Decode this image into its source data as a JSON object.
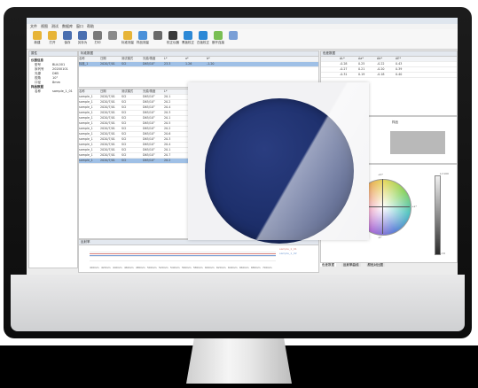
{
  "app": {
    "title": "",
    "menu": [
      "文件",
      "视图",
      "测试",
      "数据库",
      "窗口",
      "帮助"
    ],
    "toolbar": [
      {
        "label": "新建",
        "icon": "folder-icon",
        "color": "#e7b437"
      },
      {
        "label": "打开",
        "icon": "open-icon",
        "color": "#e7b437"
      },
      {
        "label": "保存",
        "icon": "save-icon",
        "color": "#4a6fb0"
      },
      {
        "label": "另存为",
        "icon": "save-as-icon",
        "color": "#4a6fb0"
      },
      {
        "label": "打印",
        "icon": "print-icon",
        "color": "#7a7a7a"
      },
      {
        "label": "",
        "icon": "settings-icon",
        "color": "#8a8a8a"
      },
      {
        "label": "标准测量",
        "icon": "measure-icon",
        "color": "#e7b437"
      },
      {
        "label": "样品测量",
        "icon": "sample-icon",
        "color": "#4a90d9"
      },
      {
        "label": "",
        "icon": "instrument-icon",
        "color": "#6a6a6a"
      },
      {
        "label": "校正仪器",
        "icon": "calibrate-icon",
        "color": "#3a3a3a"
      },
      {
        "label": "黑板校正",
        "icon": "blackboard-icon",
        "color": "#2d89d6"
      },
      {
        "label": "白板校正",
        "icon": "whiteboard-icon",
        "color": "#2d89d6"
      },
      {
        "label": "断开连接",
        "icon": "disconnect-icon",
        "color": "#7abf54"
      },
      {
        "label": "",
        "icon": "chart-icon",
        "color": "#7a9fd6"
      }
    ]
  },
  "left_panel": {
    "header": "属性",
    "group1": "仪器信息",
    "props": [
      {
        "k": "型号",
        "v": "BLK-001"
      },
      {
        "k": "序列号",
        "v": "20200101"
      },
      {
        "k": "光源",
        "v": "D65"
      },
      {
        "k": "视角",
        "v": "10°"
      },
      {
        "k": "口径",
        "v": "8mm"
      }
    ],
    "group2": "样品数据",
    "props2": [
      {
        "k": "名称",
        "v": "sample_1_01"
      }
    ]
  },
  "standard_table": {
    "header": "标准数据",
    "columns": [
      "名称",
      "日期",
      "测试模式",
      "光源/角度",
      "L*",
      "a*",
      "b*"
    ],
    "rows": [
      [
        "标准_1",
        "2020/7/01",
        "SCI",
        "D65/10°",
        "23.3",
        "1.26",
        "-1.20"
      ]
    ]
  },
  "sample_table": {
    "columns": [
      "名称",
      "日期",
      "测试模式",
      "光源/角度",
      "L*"
    ],
    "rows": [
      [
        "sample_1",
        "2020/7/01",
        "SCI",
        "D65/10°",
        "20.1"
      ],
      [
        "sample_1",
        "2020/7/01",
        "SCI",
        "D65/10°",
        "20.2"
      ],
      [
        "sample_1",
        "2020/7/01",
        "SCI",
        "D65/10°",
        "20.4"
      ],
      [
        "sample_1",
        "2020/7/01",
        "SCI",
        "D65/10°",
        "20.3"
      ],
      [
        "sample_1",
        "2020/7/01",
        "SCI",
        "D65/10°",
        "20.1"
      ],
      [
        "sample_1",
        "2020/7/01",
        "SCI",
        "D65/10°",
        "20.5"
      ],
      [
        "sample_1",
        "2020/7/01",
        "SCI",
        "D65/10°",
        "20.2"
      ],
      [
        "sample_1",
        "2020/7/01",
        "SCI",
        "D65/10°",
        "20.6"
      ],
      [
        "sample_1",
        "2020/7/01",
        "SCI",
        "D65/10°",
        "20.3"
      ],
      [
        "sample_1",
        "2020/7/01",
        "SCI",
        "D65/10°",
        "20.4"
      ],
      [
        "sample_1",
        "2020/7/01",
        "SCI",
        "D65/10°",
        "20.1"
      ],
      [
        "sample_1",
        "2020/7/01",
        "SCI",
        "D65/10°",
        "20.7"
      ],
      [
        "sample_1",
        "2020/7/01",
        "SCI",
        "D65/10°",
        "20.2"
      ]
    ],
    "selected_index": 12
  },
  "right_top": {
    "header": "色差数据",
    "columns": [
      "",
      "ΔL*",
      "Δa*",
      "Δb*",
      "ΔE*",
      "",
      ""
    ],
    "rows": [
      [
        "",
        "-0.28",
        "0.25",
        "-0.22",
        "0.43",
        "",
        ""
      ],
      [
        "",
        "-0.27",
        "0.21",
        "-0.20",
        "0.39",
        "",
        ""
      ],
      [
        "",
        "-0.31",
        "0.19",
        "-0.18",
        "0.40",
        "",
        ""
      ]
    ]
  },
  "compare": {
    "left_label": "标准",
    "right_label": "样品",
    "std_color": "#b5b5b5",
    "smp_color": "#b9b9b9"
  },
  "color_wheel": {
    "top_label": "+b*",
    "bottom_label": "-b*",
    "left_label": "-a*",
    "right_label": "+a*",
    "bar_top": "L=100",
    "bar_bottom": "L=0"
  },
  "bottom_tabs": [
    "色差数据",
    "反射率曲线",
    "颜色对比图"
  ],
  "spectral": {
    "header": "反射率",
    "legend": [
      "sample_1_01",
      "sample_1_02"
    ],
    "x_ticks": [
      "400nm",
      "420nm",
      "440nm",
      "460nm",
      "480nm",
      "500nm",
      "520nm",
      "540nm",
      "560nm",
      "580nm",
      "600nm",
      "620nm",
      "640nm",
      "660nm",
      "680nm",
      "700nm"
    ]
  },
  "status_bar": "",
  "fabric": {
    "color": "#1d2f6b",
    "backdrop": "#f2f2f4"
  },
  "colors": {
    "window_bg": "#ececec",
    "panel_head": "#e3e8ef",
    "selected": "#9fc0e6",
    "curve1": "#d9807a",
    "curve2": "#7aa0d6"
  }
}
